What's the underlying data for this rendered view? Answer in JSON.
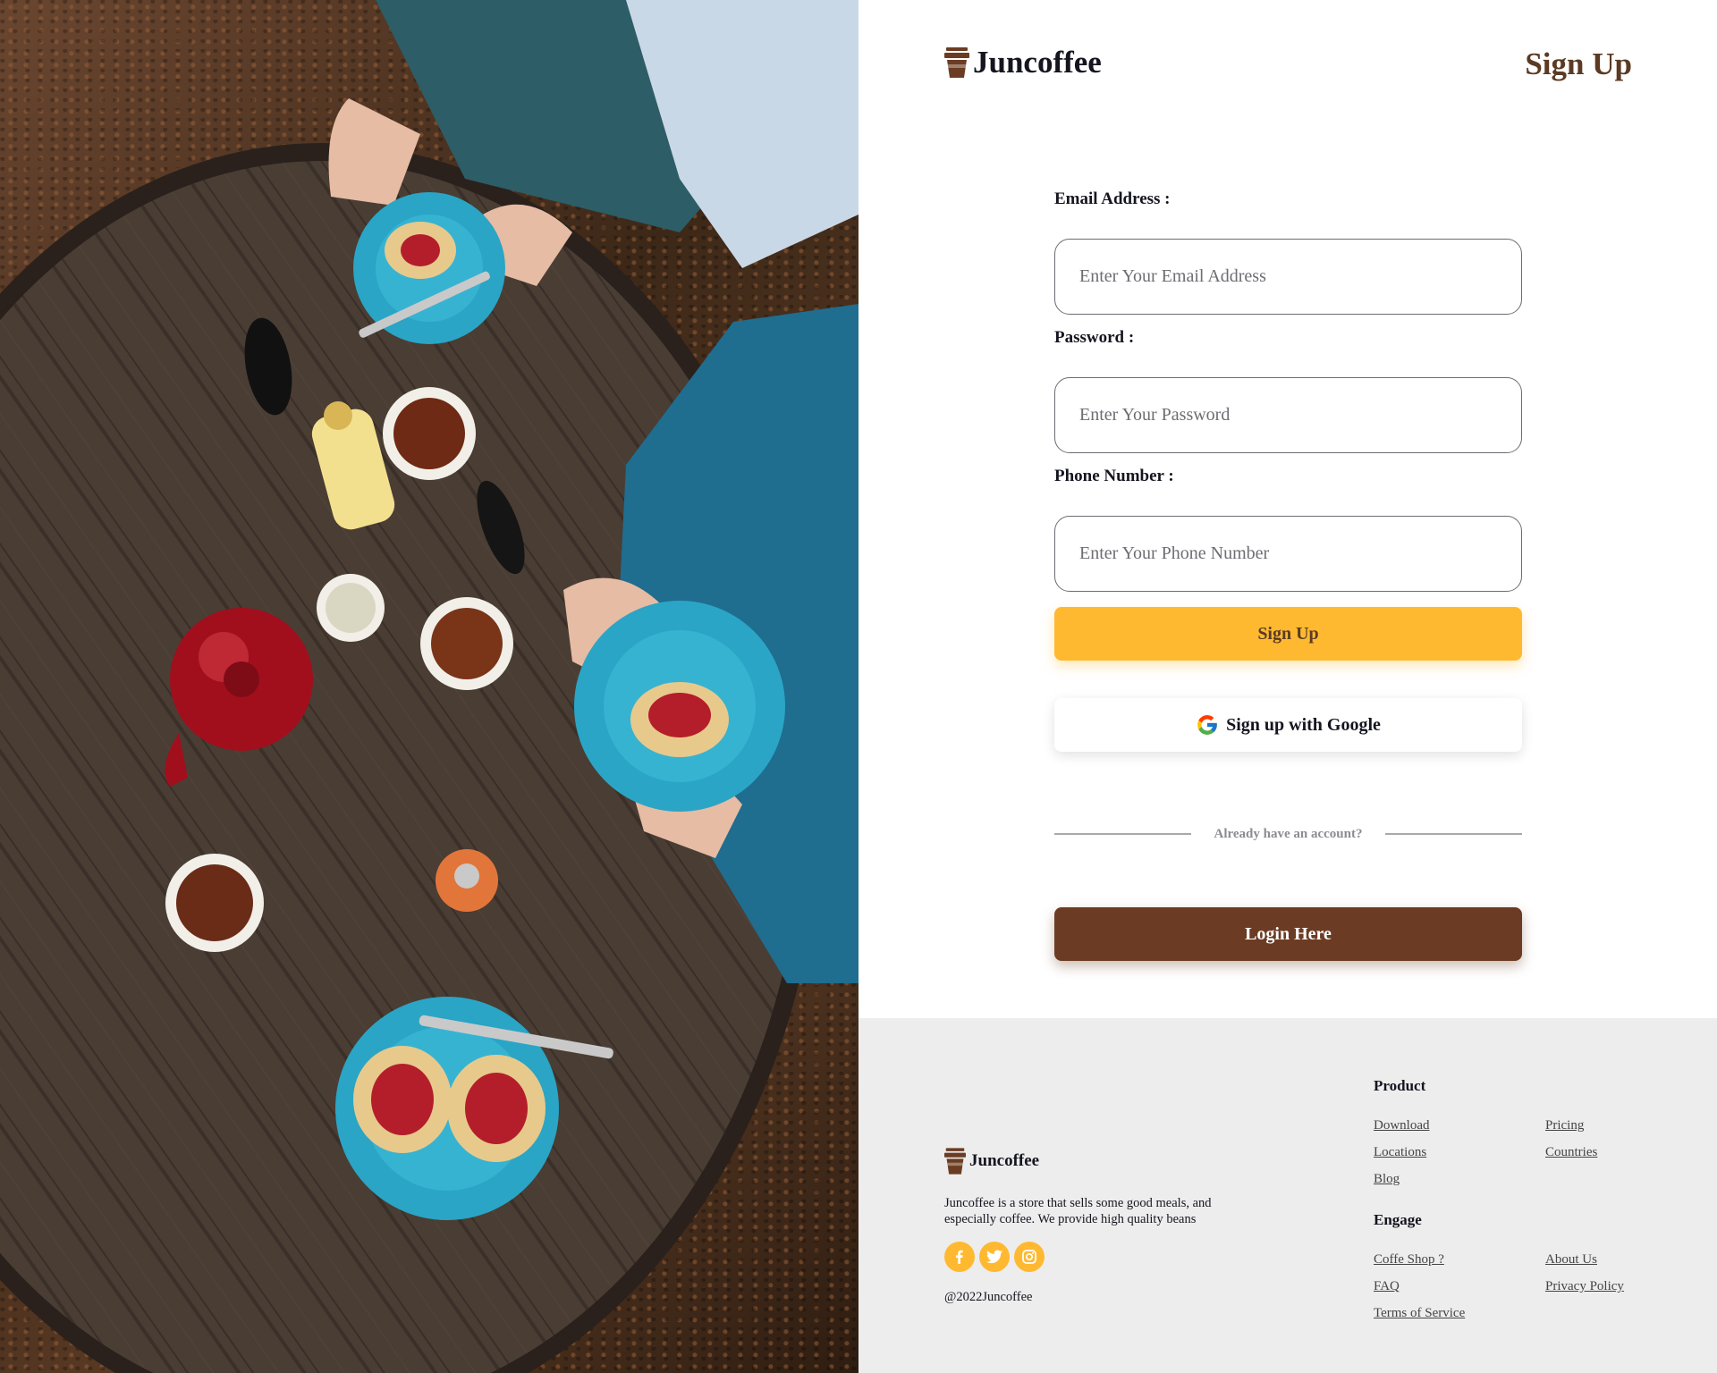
{
  "colors": {
    "accent_yellow": "#ffb931",
    "brand_brown": "#6b3c23",
    "title_brown": "#5c3a23",
    "footer_bg": "#ededed"
  },
  "hero_image": {
    "icon": "cafe-table-photo"
  },
  "header": {
    "brand": "Juncoffee",
    "brand_icon": "coffee-cup-icon",
    "page_title": "Sign Up"
  },
  "form": {
    "email": {
      "label": "Email Address :",
      "placeholder": "Enter Your Email Address",
      "value": ""
    },
    "password": {
      "label": "Password :",
      "placeholder": "Enter Your Password",
      "value": ""
    },
    "phone": {
      "label": "Phone Number :",
      "placeholder": "Enter Your Phone Number",
      "value": ""
    },
    "signup_button": "Sign Up",
    "google_button": "Sign up with Google",
    "google_icon": "google-icon",
    "divider_text": "Already have an account?",
    "login_button": "Login Here"
  },
  "footer": {
    "brand": "Juncoffee",
    "description": "Juncoffee is a store that sells some good meals, and especially coffee. We provide high quality beans",
    "socials": [
      "facebook-icon",
      "twitter-icon",
      "instagram-icon"
    ],
    "copyright": "@2022Juncoffee",
    "product": {
      "heading": "Product",
      "links": [
        "Download",
        "Pricing",
        "Locations",
        "Countries",
        "Blog"
      ]
    },
    "engage": {
      "heading": "Engage",
      "links": [
        "Coffe Shop ?",
        "About Us",
        "FAQ",
        "Privacy Policy",
        "Terms of Service"
      ]
    }
  }
}
